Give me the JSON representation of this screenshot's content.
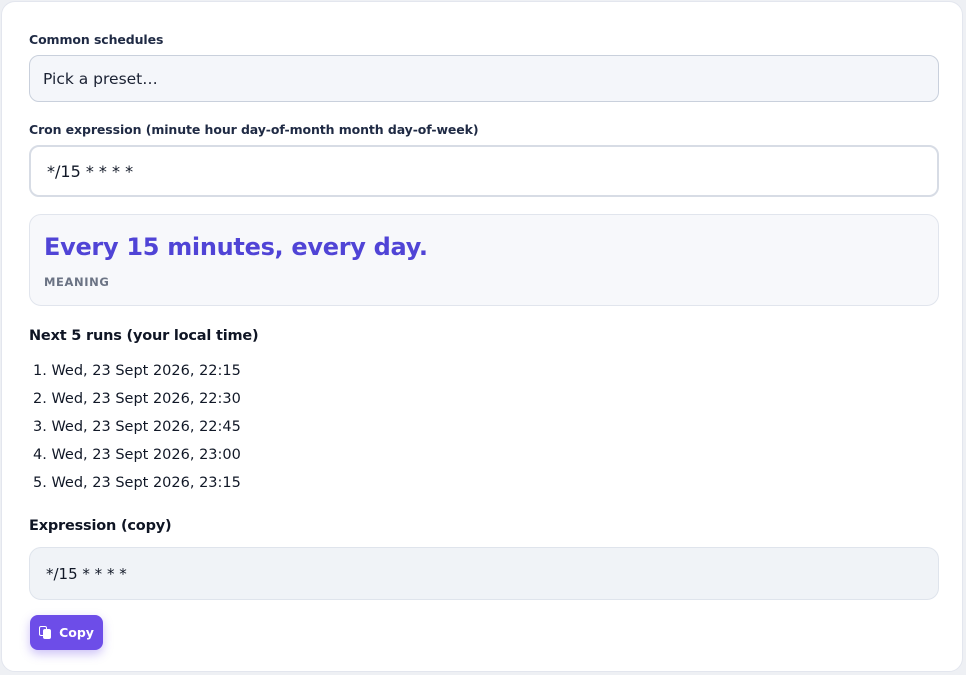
{
  "presets": {
    "label": "Common schedules",
    "selected": "Pick a preset…"
  },
  "cron": {
    "label": "Cron expression (minute hour day-of-month month day-of-week)",
    "value": "*/15 * * * *"
  },
  "meaning": {
    "text": "Every 15 minutes, every day.",
    "caption": "MEANING"
  },
  "next_runs": {
    "heading": "Next 5 runs (your local time)",
    "items": [
      "1. Wed, 23 Sept 2026, 22:15",
      "2. Wed, 23 Sept 2026, 22:30",
      "3. Wed, 23 Sept 2026, 22:45",
      "4. Wed, 23 Sept 2026, 23:00",
      "5. Wed, 23 Sept 2026, 23:15"
    ]
  },
  "copy_section": {
    "heading": "Expression (copy)",
    "value": "*/15 * * * *",
    "button_label": "Copy",
    "button_icon": "copy-icon"
  },
  "colors": {
    "accent": "#5044d6",
    "button": "#6d4de8"
  }
}
